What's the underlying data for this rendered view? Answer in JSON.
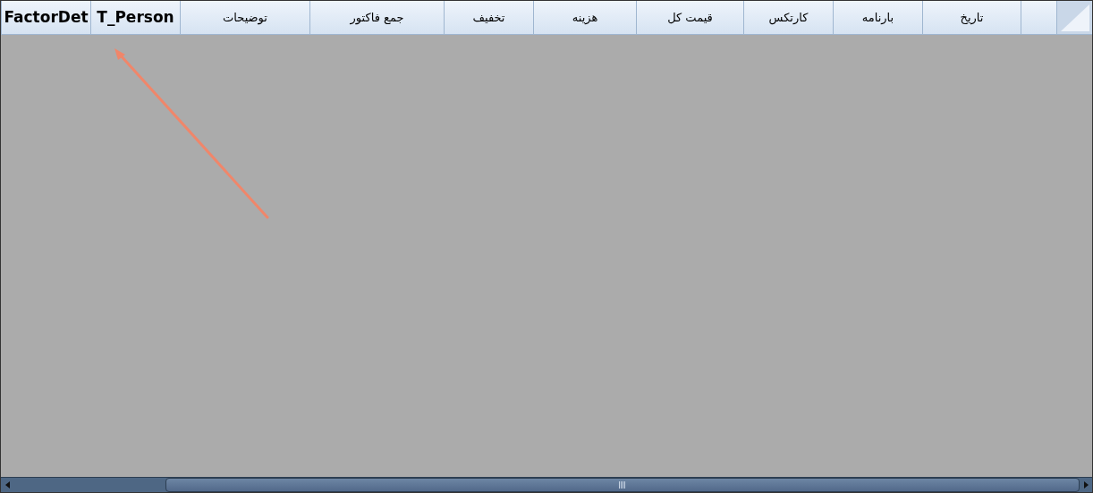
{
  "grid": {
    "columns": [
      {
        "label": "تاریخ",
        "kind": "normal"
      },
      {
        "label": "بارنامه",
        "kind": "normal"
      },
      {
        "label": "کارتکس",
        "kind": "normal"
      },
      {
        "label": "قیمت کل",
        "kind": "normal"
      },
      {
        "label": "هزینه",
        "kind": "normal"
      },
      {
        "label": "تخفیف",
        "kind": "normal"
      },
      {
        "label": "جمع فاکتور",
        "kind": "normal"
      },
      {
        "label": "توضیحات",
        "kind": "normal"
      },
      {
        "label": "T_Person",
        "kind": "bold"
      },
      {
        "label": "FactorDet",
        "kind": "bold"
      }
    ]
  }
}
